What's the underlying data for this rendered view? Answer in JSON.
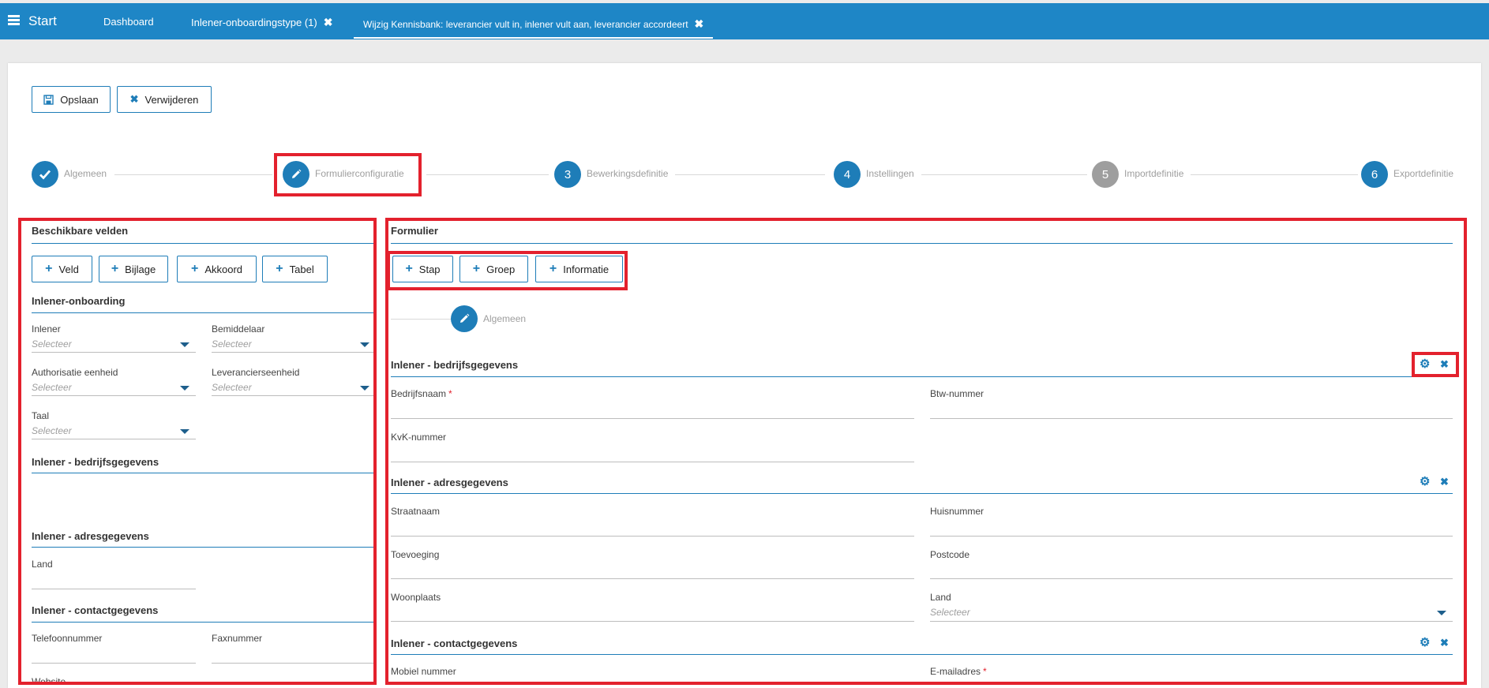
{
  "topbar": {
    "start": "Start",
    "tabs": [
      {
        "label": "Dashboard"
      },
      {
        "label": "Inlener-onboardingstype (1)"
      },
      {
        "label": "Wijzig Kennisbank: leverancier vult in, inlener vult aan, leverancier accordeert"
      }
    ]
  },
  "toolbar": {
    "save": "Opslaan",
    "delete": "Verwijderen"
  },
  "steps": [
    {
      "label": "Algemeen",
      "number": ""
    },
    {
      "label": "Formulierconfiguratie",
      "number": ""
    },
    {
      "label": "Bewerkingsdefinitie",
      "number": "3"
    },
    {
      "label": "Instellingen",
      "number": "4"
    },
    {
      "label": "Importdefinitie",
      "number": "5"
    },
    {
      "label": "Exportdefinitie",
      "number": "6"
    }
  ],
  "left": {
    "title": "Beschikbare velden",
    "buttons": [
      "Veld",
      "Bijlage",
      "Akkoord",
      "Tabel"
    ],
    "placeholder": "Selecteer",
    "sections": {
      "onboarding": {
        "title": "Inlener-onboarding",
        "fields": [
          "Inlener",
          "Bemiddelaar",
          "Authorisatie eenheid",
          "Leverancierseenheid",
          "Taal"
        ]
      },
      "bedrijf": {
        "title": "Inlener - bedrijfsgegevens"
      },
      "adres": {
        "title": "Inlener - adresgegevens",
        "fields": [
          "Land"
        ]
      },
      "contact": {
        "title": "Inlener - contactgegevens",
        "fields": [
          "Telefoonnummer",
          "Faxnummer",
          "Website"
        ]
      }
    }
  },
  "right": {
    "title": "Formulier",
    "buttons": [
      "Stap",
      "Groep",
      "Informatie"
    ],
    "step_label": "Algemeen",
    "placeholder": "Selecteer",
    "groups": {
      "bedrijf": {
        "title": "Inlener - bedrijfsgegevens",
        "fields": [
          "Bedrijfsnaam",
          "Btw-nummer",
          "KvK-nummer"
        ]
      },
      "adres": {
        "title": "Inlener - adresgegevens",
        "fields": [
          "Straatnaam",
          "Huisnummer",
          "Toevoeging",
          "Postcode",
          "Woonplaats",
          "Land"
        ]
      },
      "contact": {
        "title": "Inlener - contactgegevens",
        "fields": [
          "Mobiel nummer",
          "E-mailadres"
        ]
      }
    }
  },
  "colors": {
    "accent": "#1e7db8",
    "topbar": "#1e86c6",
    "highlight": "#e3212d",
    "inactive_step": "#9e9e9e"
  }
}
